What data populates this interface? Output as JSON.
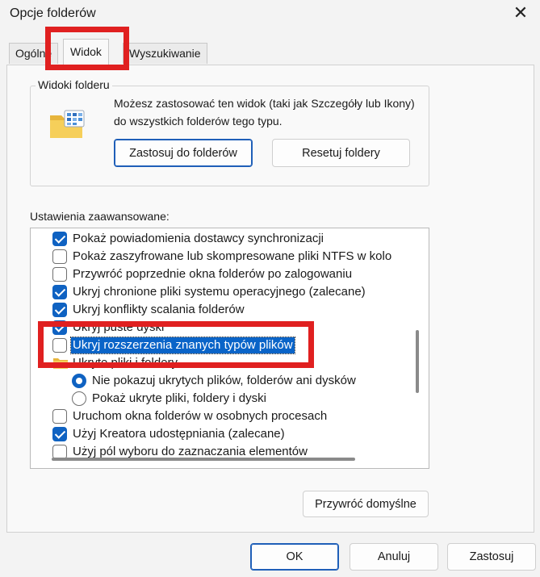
{
  "window": {
    "title": "Opcje folderów",
    "close_icon": "close-icon"
  },
  "tabs": [
    {
      "label": "Ogólne"
    },
    {
      "label": "Widok"
    },
    {
      "label": "Wyszukiwanie"
    }
  ],
  "folder_views": {
    "legend": "Widoki folderu",
    "description": "Możesz zastosować ten widok (taki jak Szczegóły lub Ikony) do wszystkich folderów tego typu.",
    "apply_button": "Zastosuj do folderów",
    "reset_button": "Resetuj foldery"
  },
  "advanced": {
    "label": "Ustawienia zaawansowane:",
    "items": [
      {
        "type": "checkbox",
        "checked": true,
        "label": "Pokaż powiadomienia dostawcy synchronizacji"
      },
      {
        "type": "checkbox",
        "checked": false,
        "label": "Pokaż zaszyfrowane lub skompresowane pliki NTFS w kolo"
      },
      {
        "type": "checkbox",
        "checked": false,
        "label": "Przywróć poprzednie okna folderów po zalogowaniu"
      },
      {
        "type": "checkbox",
        "checked": true,
        "label": "Ukryj chronione pliki systemu operacyjnego (zalecane)"
      },
      {
        "type": "checkbox",
        "checked": true,
        "label": "Ukryj konflikty scalania folderów"
      },
      {
        "type": "checkbox",
        "checked": true,
        "label": "Ukryj puste dyski"
      },
      {
        "type": "checkbox",
        "checked": false,
        "label": "Ukryj rozszerzenia znanych typów plików",
        "selected": true
      },
      {
        "type": "folder",
        "label": "Ukryte pliki i foldery"
      },
      {
        "type": "radio",
        "checked": true,
        "label": "Nie pokazuj ukrytych plików, folderów ani dysków"
      },
      {
        "type": "radio",
        "checked": false,
        "label": "Pokaż ukryte pliki, foldery i dyski"
      },
      {
        "type": "checkbox",
        "checked": false,
        "label": "Uruchom okna folderów w osobnych procesach"
      },
      {
        "type": "checkbox",
        "checked": true,
        "label": "Użyj Kreatora udostępniania (zalecane)"
      },
      {
        "type": "checkbox",
        "checked": false,
        "label": "Użyj pól wyboru do zaznaczania elementów"
      }
    ]
  },
  "restore_defaults_button": "Przywróć domyślne",
  "footer": {
    "ok": "OK",
    "cancel": "Anuluj",
    "apply": "Zastosuj"
  },
  "colors": {
    "accent": "#0f62c2",
    "highlight_box": "#e02020"
  }
}
